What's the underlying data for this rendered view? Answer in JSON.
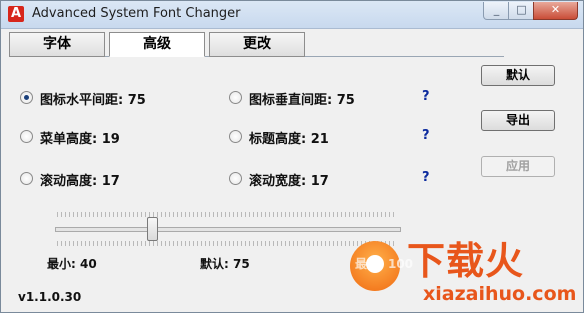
{
  "window": {
    "title": "Advanced System Font Changer",
    "app_icon": "A",
    "minimize": "_",
    "maximize": "□",
    "close": "✕"
  },
  "tabs": [
    "字体",
    "高级",
    "更改"
  ],
  "options": {
    "icon_h_spacing": "图标水平间距: 75",
    "icon_v_spacing": "图标垂直间距: 75",
    "menu_height": "菜单高度: 19",
    "title_height": "标题高度: 21",
    "scroll_height": "滚动高度: 17",
    "scroll_width": "滚动宽度: 17",
    "help": "?"
  },
  "buttons": {
    "default": "默认",
    "export": "导出",
    "apply": "应用"
  },
  "slider": {
    "min": 40,
    "max": 100,
    "value": 75,
    "min_label": "最小: 40",
    "default_label": "默认: 75",
    "max_label": "最大: 100"
  },
  "version": "v1.1.0.30",
  "watermark": {
    "cn": "下载火",
    "url": "xiazaihuo.com"
  }
}
